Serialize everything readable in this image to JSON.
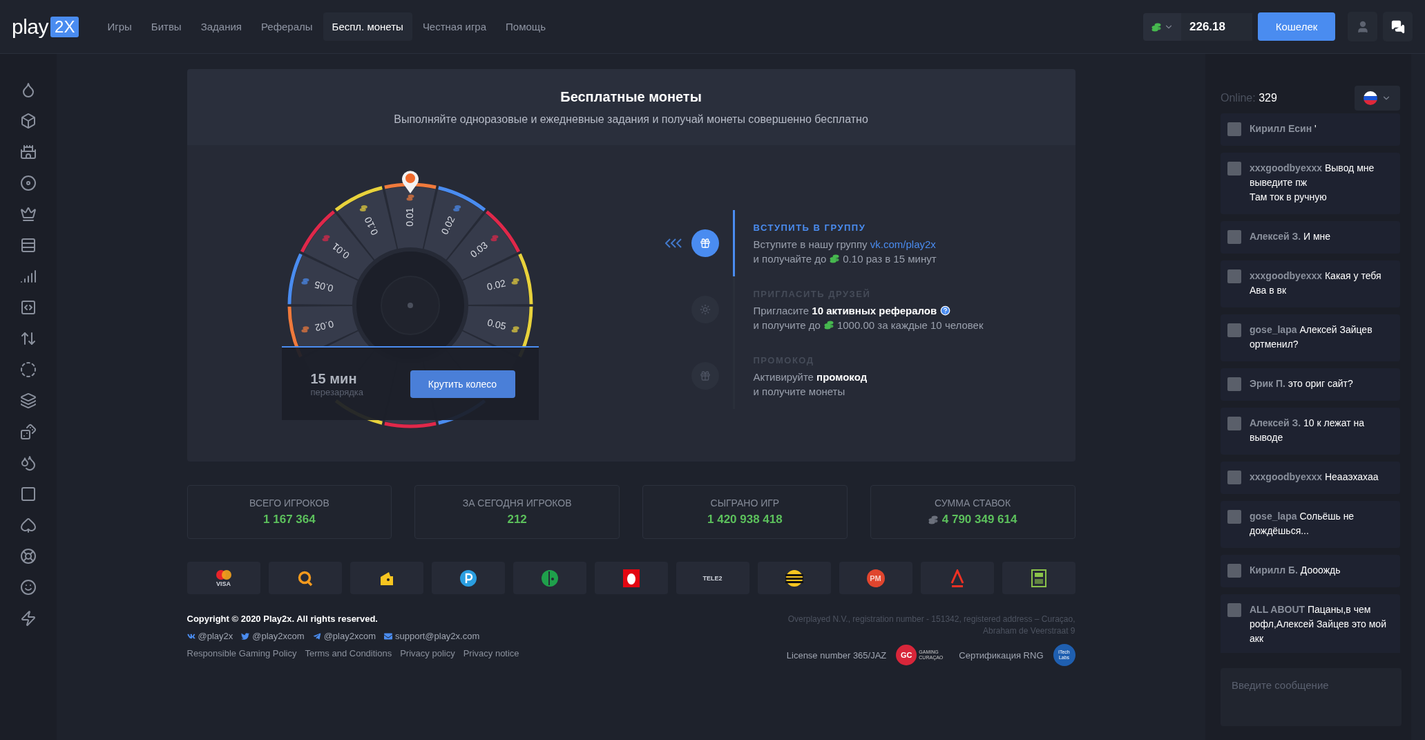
{
  "header": {
    "logo": {
      "word": "play",
      "badge": "2X"
    },
    "nav": [
      {
        "label": "Игры",
        "selected": false
      },
      {
        "label": "Битвы",
        "selected": false
      },
      {
        "label": "Задания",
        "selected": false
      },
      {
        "label": "Рефералы",
        "selected": false
      },
      {
        "label": "Беспл. монеты",
        "selected": true
      },
      {
        "label": "Честная игра",
        "selected": false
      },
      {
        "label": "Помощь",
        "selected": false
      }
    ],
    "balance": "226.18",
    "wallet_button": "Кошелек"
  },
  "free_coins": {
    "title": "Бесплатные монеты",
    "subtitle": "Выполняйте одноразовые и ежедневные задания и получай монеты совершенно бесплатно",
    "wheel": {
      "segments": [
        {
          "value": "0.01",
          "color": "#f07a3c"
        },
        {
          "value": "0.02",
          "color": "#4a8cf0"
        },
        {
          "value": "0.03",
          "color": "#e0284a"
        },
        {
          "value": "0.02",
          "color": "#e8d23c"
        },
        {
          "value": "0.05",
          "color": "#e8d23c"
        },
        {
          "kind": "hidden"
        },
        {
          "color": "#4a8cf0"
        },
        {
          "color": "#e0284a"
        },
        {
          "color": "#e8d23c"
        },
        {
          "kind": "hidden"
        },
        {
          "value": "0.02",
          "color": "#f07a3c"
        },
        {
          "value": "0.05",
          "color": "#4a8cf0"
        },
        {
          "value": "0.01",
          "color": "#e0284a"
        },
        {
          "value": "0.10",
          "color": "#e8d23c"
        }
      ],
      "cooldown": "15 мин",
      "cooldown_label": "перезарядка",
      "spin_button": "Крутить колесо"
    },
    "tasks": [
      {
        "title": "ВСТУПИТЬ В ГРУППУ",
        "selected": true,
        "kind": "gift",
        "line1": "Вступите в нашу группу",
        "link": "vk.com/play2x",
        "line2": "и получайте до",
        "amount": "0.10 раз в 15 минут"
      },
      {
        "title": "ПРИГЛАСИТЬ ДРУЗЕЙ",
        "selected": false,
        "kind": "friends",
        "line1": "Пригласите **10 активных рефералов**",
        "help": true,
        "line2": "и получите до",
        "amount": "1000.00 за каждые 10 человек"
      },
      {
        "title": "ПРОМОКОД",
        "selected": false,
        "kind": "gift",
        "line1": "Активируйте **промокод**",
        "line2": "и получите монеты"
      }
    ]
  },
  "stats": [
    {
      "label": "ВСЕГО ИГРОКОВ",
      "value": "1 167 364"
    },
    {
      "label": "ЗА СЕГОДНЯ ИГРОКОВ",
      "value": "212"
    },
    {
      "label": "СЫГРАНО ИГР",
      "value": "1 420 938 418"
    },
    {
      "label": "СУММА СТАВОК",
      "value": "4 790 349 614",
      "coins": true
    }
  ],
  "payments": [
    {
      "kind": "cards",
      "label": "VISA"
    },
    {
      "kind": "qiwi"
    },
    {
      "kind": "wallet"
    },
    {
      "kind": "payeer"
    },
    {
      "kind": "phone"
    },
    {
      "kind": "egg"
    },
    {
      "kind": "tele",
      "label": "TELE2"
    },
    {
      "kind": "stripes"
    },
    {
      "kind": "pm",
      "label": "PM"
    },
    {
      "kind": "alfa"
    },
    {
      "kind": "terminal"
    }
  ],
  "footer": {
    "copyright": "Copyright © 2020 Play2x. All rights reserved.",
    "socials": [
      {
        "kind": "vk",
        "label": "@play2x"
      },
      {
        "kind": "twitter",
        "label": "@play2xcom"
      },
      {
        "kind": "telegram",
        "label": "@play2xcom"
      },
      {
        "kind": "mail",
        "label": "support@play2x.com"
      }
    ],
    "links": [
      "Responsible Gaming Policy",
      "Terms and Conditions",
      "Privacy policy",
      "Privacy notice"
    ],
    "registration": [
      "Overplayed N.V., registration number - 151342, registered address – Curaçao,",
      "Abraham de Veerstraat 9"
    ],
    "license": "License number 365/JAZ",
    "gc_logo": {
      "mark": "GC",
      "text": "GAMING CURAÇAO"
    },
    "rng": "Сертификация RNG",
    "itech_logo": "iTech Labs"
  },
  "chat": {
    "online_label": "Online:",
    "online_count": "329",
    "placeholder": "Введите сообщение",
    "messages": [
      {
        "name": "Кирилл Есин",
        "text": "'"
      },
      {
        "name": "xxxgoodbyexxx",
        "text": "Вывод мне выведите пж\nТам ток в ручную"
      },
      {
        "name": "Алексей З.",
        "text": "И мне"
      },
      {
        "name": "xxxgoodbyexxx",
        "text": "Какая у тебя Ава в вк"
      },
      {
        "name": "gose_lapa",
        "text": "Алексей Зайцев ортменил?"
      },
      {
        "name": "Эрик П.",
        "text": "это ориг сайт?"
      },
      {
        "name": "Алексей З.",
        "text": "10 к лежат на выводе"
      },
      {
        "name": "xxxgoodbyexxx",
        "text": "Неааэхахаа"
      },
      {
        "name": "gose_lapa",
        "text": "Сольёшь не дождёшься..."
      },
      {
        "name": "Кирилл Б.",
        "text": "Дооождь"
      },
      {
        "name": "ALL ABOUT",
        "text": "Пацаны,в чем рофл,Алексей Зайцев это мой акк"
      }
    ]
  }
}
